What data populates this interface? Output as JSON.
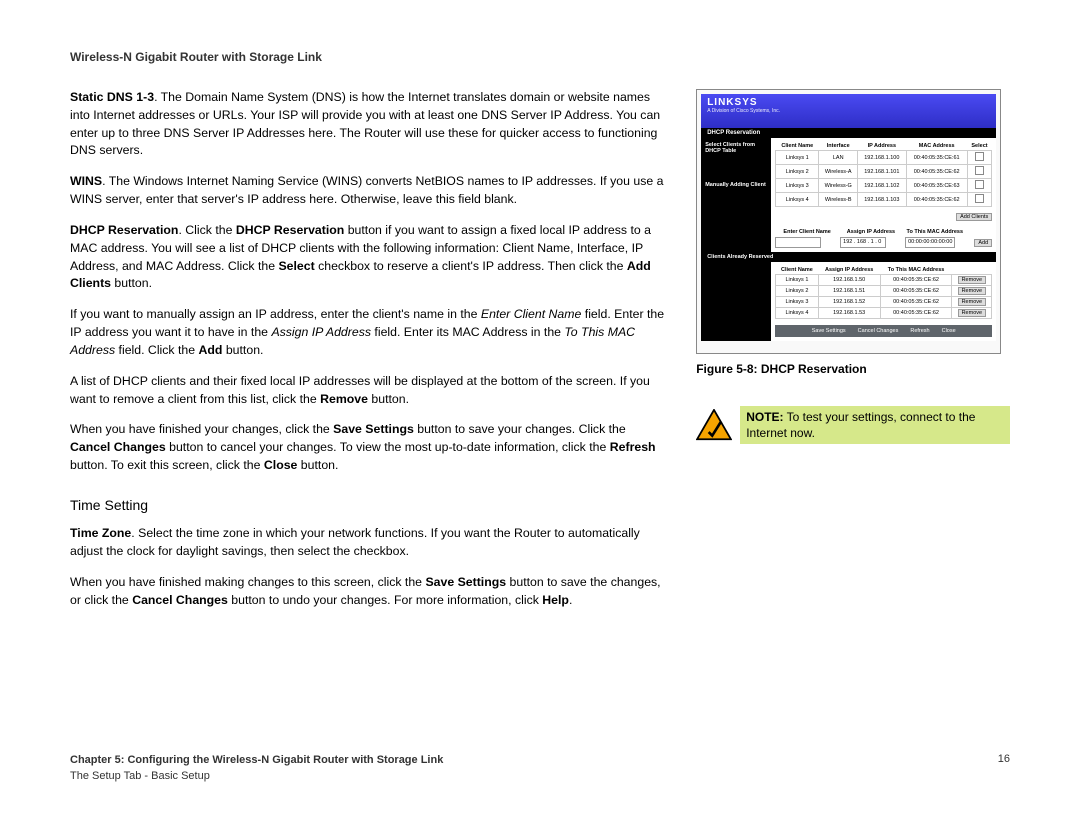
{
  "header": {
    "title": "Wireless-N Gigabit Router with Storage Link"
  },
  "body": {
    "p1_pre": "Static DNS 1-3",
    "p1_rest": ". The Domain Name System (DNS) is how the Internet translates domain or website names into Internet addresses or URLs. Your ISP will provide you with at least one DNS Server IP Address. You can enter up to three DNS Server IP Addresses here. The Router will use these for quicker access to functioning DNS servers.",
    "p2_pre": "WINS",
    "p2_rest": ". The Windows Internet Naming Service (WINS) converts NetBIOS names to IP addresses. If you use a WINS server, enter that server's IP address here. Otherwise, leave this field blank.",
    "p3_a": "DHCP Reservation",
    "p3_b": ". Click the ",
    "p3_c": "DHCP Reservation",
    "p3_d": " button if you want to assign a fixed local IP address to a MAC address. You will see a list of DHCP clients with the following information: Client Name, Interface, IP Address, and MAC Address. Click the ",
    "p3_e": "Select",
    "p3_f": " checkbox to reserve a client's IP address. Then click the ",
    "p3_g": "Add Clients",
    "p3_h": " button.",
    "p4_a": "If you want to manually assign an IP address, enter the client's name in the ",
    "p4_b": "Enter Client Name",
    "p4_c": " field. Enter the IP address you want it to have in the ",
    "p4_d": "Assign IP Address",
    "p4_e": " field. Enter its MAC Address in the ",
    "p4_f": "To This MAC Address",
    "p4_g": " field. Click the ",
    "p4_h": "Add",
    "p4_i": " button.",
    "p5_a": "A list of DHCP clients and their fixed local IP addresses will be displayed at the bottom of the screen. If you want to remove a client from this list, click the ",
    "p5_b": "Remove",
    "p5_c": " button.",
    "p6_a": "When you have finished your changes, click the ",
    "p6_b": "Save Settings",
    "p6_c": " button to save your changes. Click the ",
    "p6_d": "Cancel Changes",
    "p6_e": " button to cancel your changes. To view the most up-to-date information, click the ",
    "p6_f": "Refresh",
    "p6_g": " button. To exit this screen, click the ",
    "p6_h": "Close",
    "p6_i": " button.",
    "time_heading": "Time Setting",
    "p7_a": "Time Zone",
    "p7_b": ". Select the time zone in which your network functions. If you want the Router to automatically adjust the clock for daylight savings, then select the checkbox.",
    "p8_a": "When you have finished making changes to this screen, click the ",
    "p8_b": "Save Settings",
    "p8_c": " button to save the changes, or click the ",
    "p8_d": "Cancel Changes",
    "p8_e": " button to undo your changes. For more information, click ",
    "p8_f": "Help",
    "p8_g": "."
  },
  "figure": {
    "brand": "LINKSYS",
    "brand_sub": "A Division of Cisco Systems, Inc.",
    "section_title": "DHCP Reservation",
    "side1": "Select Clients from DHCP Table",
    "side2": "Manually Adding Client",
    "side3": "Clients Already Reserved",
    "table1": {
      "headers": [
        "Client Name",
        "Interface",
        "IP Address",
        "MAC Address",
        "Select"
      ],
      "rows": [
        [
          "Linksys 1",
          "LAN",
          "192.168.1.100",
          "00:40:05:35:CE:61",
          ""
        ],
        [
          "Linksys 2",
          "Wireless-A",
          "192.168.1.101",
          "00:40:05:35:CE:62",
          ""
        ],
        [
          "Linksys 3",
          "Wireless-G",
          "192.168.1.102",
          "00:40:05:35:CE:63",
          ""
        ],
        [
          "Linksys 4",
          "Wireless-B",
          "192.168.1.103",
          "00:40:05:35:CE:62",
          ""
        ]
      ]
    },
    "add_clients": "Add Clients",
    "manual_headers": [
      "Enter Client Name",
      "Assign IP Address",
      "To This MAC Address"
    ],
    "manual_ip": "192 . 168 . 1 . 0",
    "manual_mac": "00:00:00:00:00:00",
    "add_btn": "Add",
    "table2": {
      "headers": [
        "Client Name",
        "Assign IP Address",
        "To This MAC Address",
        ""
      ],
      "rows": [
        [
          "Linksys 1",
          "192.168.1.50",
          "00:40:05:35:CE:62",
          "Remove"
        ],
        [
          "Linksys 2",
          "192.168.1.51",
          "00:40:05:35:CE:62",
          "Remove"
        ],
        [
          "Linksys 3",
          "192.168.1.52",
          "00:40:05:35:CE:62",
          "Remove"
        ],
        [
          "Linksys 4",
          "192.168.1.53",
          "00:40:05:35:CE:62",
          "Remove"
        ]
      ]
    },
    "buttons": [
      "Save Settings",
      "Cancel Changes",
      "Refresh",
      "Close"
    ],
    "caption": "Figure 5-8: DHCP Reservation"
  },
  "note": {
    "label": "NOTE:",
    "text": " To test your settings, connect to the Internet now."
  },
  "footer": {
    "chapter": "Chapter 5: Configuring the Wireless-N Gigabit Router with Storage Link",
    "section": "The Setup Tab - Basic Setup",
    "page_number": "16"
  }
}
